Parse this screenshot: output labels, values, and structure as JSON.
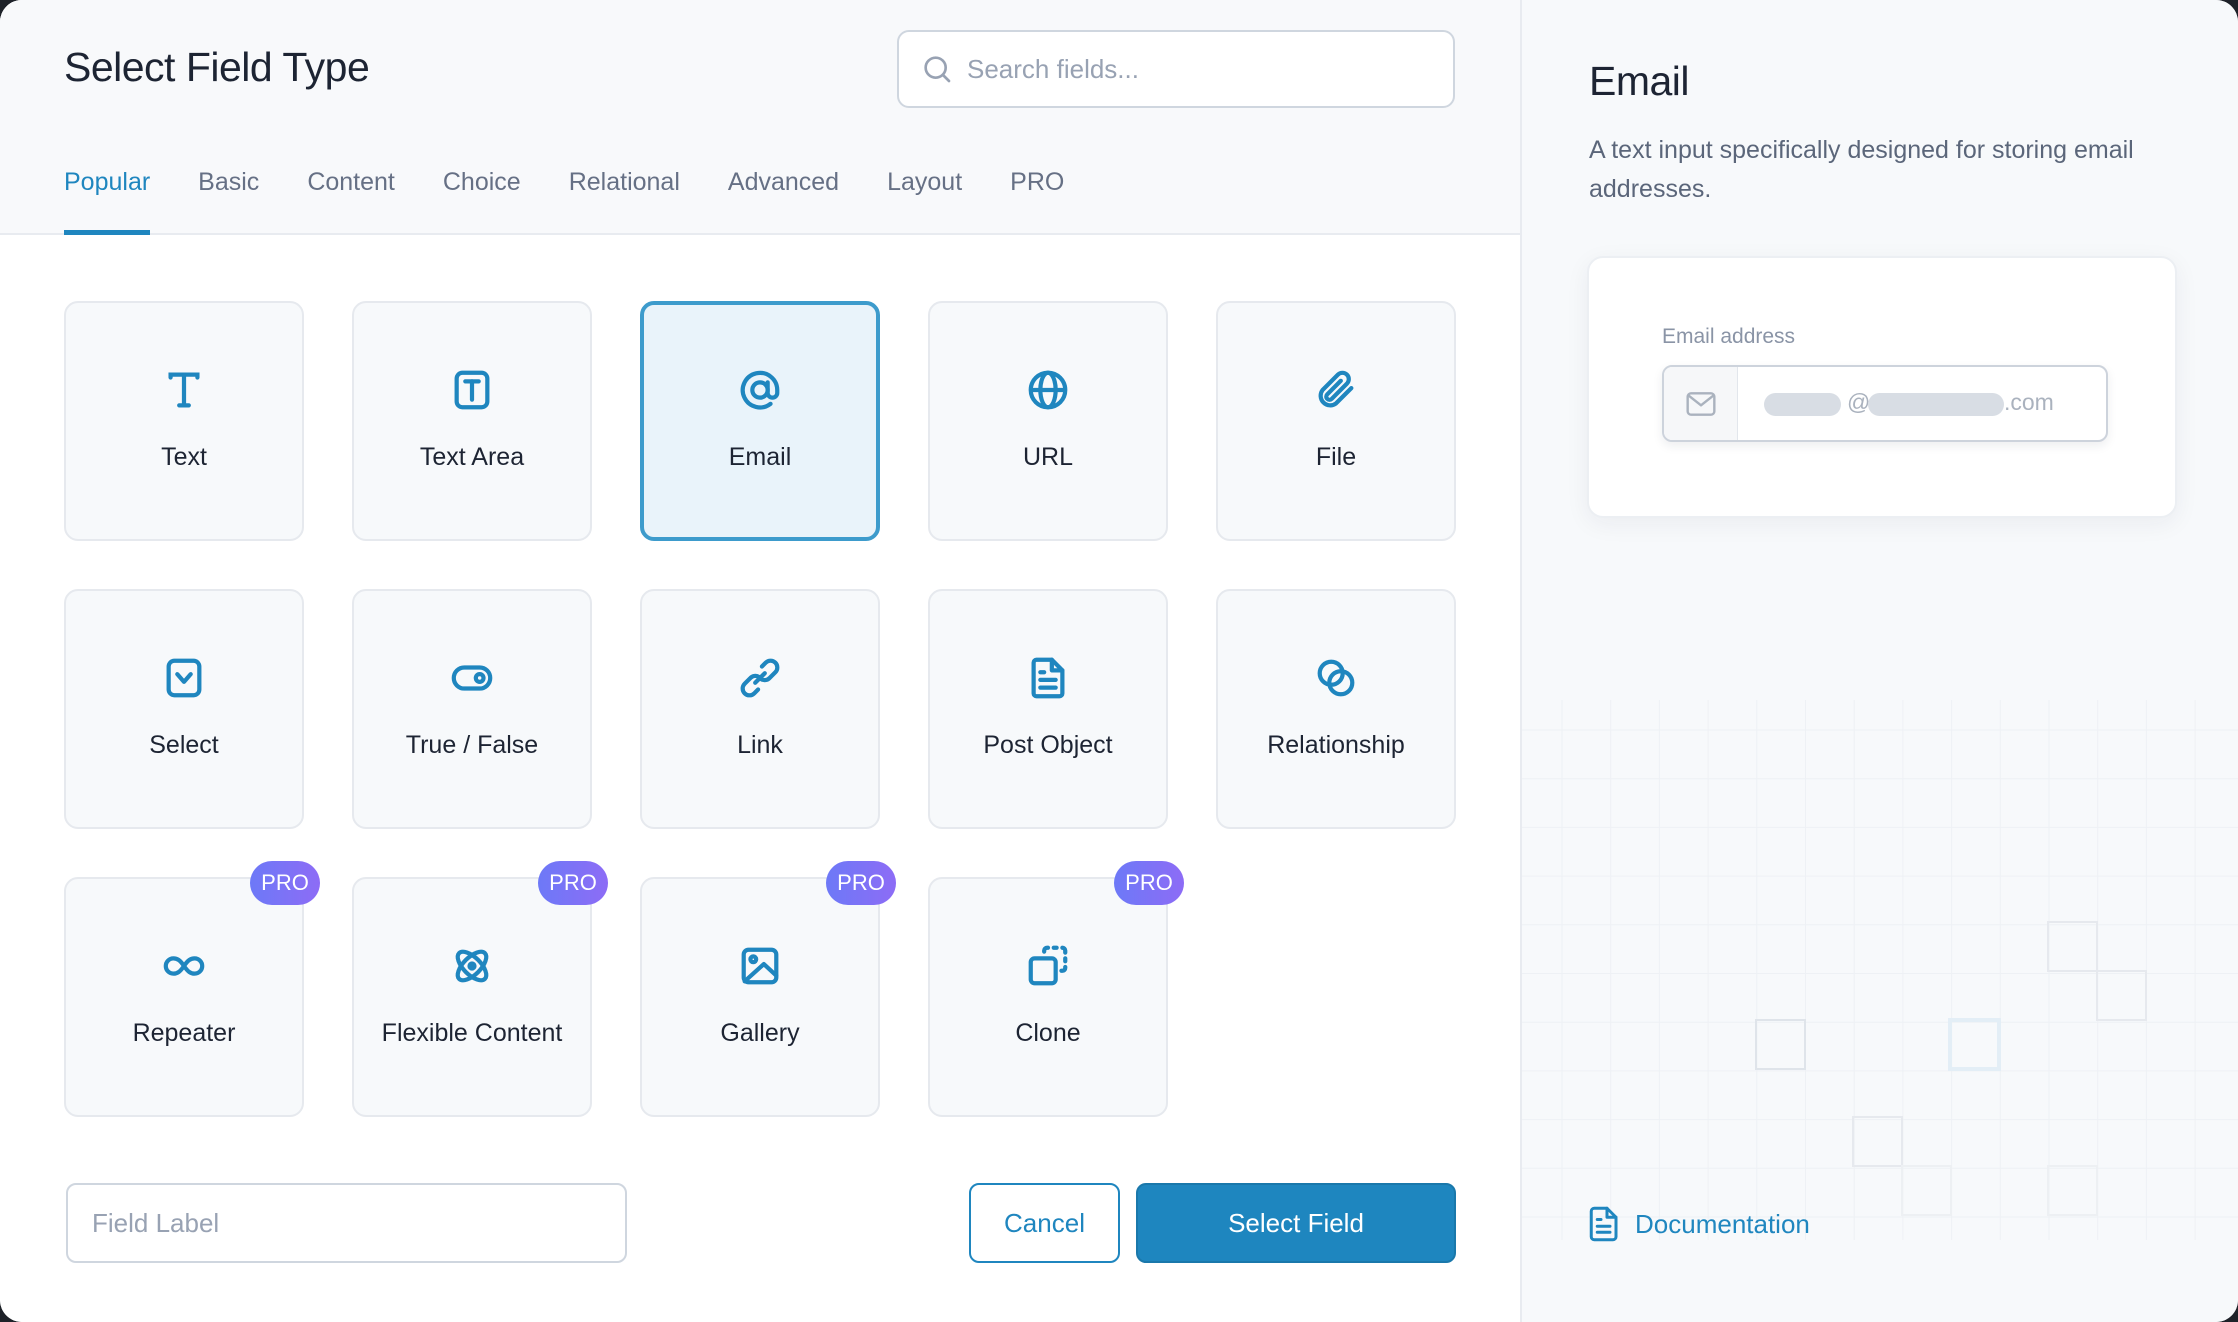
{
  "header": {
    "title": "Select Field Type",
    "search": {
      "placeholder": "Search fields...",
      "value": ""
    }
  },
  "tabs": [
    {
      "label": "Popular",
      "active": true
    },
    {
      "label": "Basic",
      "active": false
    },
    {
      "label": "Content",
      "active": false
    },
    {
      "label": "Choice",
      "active": false
    },
    {
      "label": "Relational",
      "active": false
    },
    {
      "label": "Advanced",
      "active": false
    },
    {
      "label": "Layout",
      "active": false
    },
    {
      "label": "PRO",
      "active": false
    }
  ],
  "fields": [
    {
      "label": "Text",
      "icon": "text-icon",
      "pro": false,
      "selected": false
    },
    {
      "label": "Text Area",
      "icon": "text-area-icon",
      "pro": false,
      "selected": false
    },
    {
      "label": "Email",
      "icon": "at-sign-icon",
      "pro": false,
      "selected": true
    },
    {
      "label": "URL",
      "icon": "globe-icon",
      "pro": false,
      "selected": false
    },
    {
      "label": "File",
      "icon": "paperclip-icon",
      "pro": false,
      "selected": false
    },
    {
      "label": "Select",
      "icon": "select-dropdown-icon",
      "pro": false,
      "selected": false
    },
    {
      "label": "True / False",
      "icon": "toggle-icon",
      "pro": false,
      "selected": false
    },
    {
      "label": "Link",
      "icon": "link-icon",
      "pro": false,
      "selected": false
    },
    {
      "label": "Post Object",
      "icon": "document-icon",
      "pro": false,
      "selected": false
    },
    {
      "label": "Relationship",
      "icon": "overlapping-circles-icon",
      "pro": false,
      "selected": false
    },
    {
      "label": "Repeater",
      "icon": "infinity-icon",
      "pro": true,
      "selected": false
    },
    {
      "label": "Flexible Content",
      "icon": "atom-icon",
      "pro": true,
      "selected": false
    },
    {
      "label": "Gallery",
      "icon": "image-icon",
      "pro": true,
      "selected": false
    },
    {
      "label": "Clone",
      "icon": "clone-icon",
      "pro": true,
      "selected": false
    }
  ],
  "pro_badge": "PRO",
  "footer": {
    "field_label": {
      "placeholder": "Field Label",
      "value": ""
    },
    "cancel_label": "Cancel",
    "select_label": "Select Field"
  },
  "detail": {
    "title": "Email",
    "description": "A text input specifically designed for storing email addresses.",
    "preview": {
      "label": "Email address",
      "at": "@",
      "tld": ".com"
    },
    "documentation_label": "Documentation"
  },
  "colors": {
    "accent": "#1f86bf",
    "selected_border": "#3d9bcc",
    "selected_bg": "#e9f3fa",
    "pro_gradient_start": "#6d79f7",
    "pro_gradient_end": "#8d6cf6"
  }
}
